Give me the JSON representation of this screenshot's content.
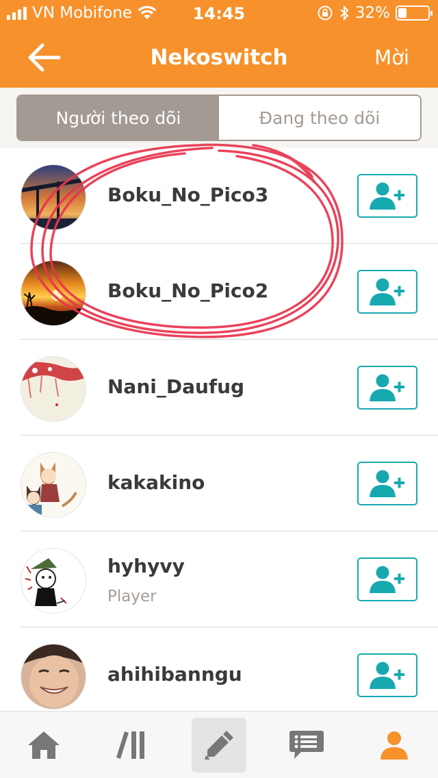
{
  "status_bar": {
    "carrier": "VN Mobifone",
    "time": "14:45",
    "battery": "32%",
    "battery_level": 0.32
  },
  "nav": {
    "title": "Nekoswitch",
    "invite_label": "Mời",
    "back_icon": "arrow-left-icon"
  },
  "tabs": {
    "followers_label": "Người theo dõi",
    "following_label": "Đang theo dõi",
    "selected": "followers"
  },
  "users": [
    {
      "name": "Boku_No_Pico3",
      "subtitle": "",
      "avatar": "bridge-sunset-photo"
    },
    {
      "name": "Boku_No_Pico2",
      "subtitle": "",
      "avatar": "orange-sunset-photo"
    },
    {
      "name": "Nani_Daufug",
      "subtitle": "",
      "avatar": "red-ink-painting"
    },
    {
      "name": "kakakino",
      "subtitle": "",
      "avatar": "anime-cat-kids-drawing"
    },
    {
      "name": "hyhyvy",
      "subtitle": "Player",
      "avatar": "sketch-character-drawing"
    },
    {
      "name": "ahihibanngu",
      "subtitle": "",
      "avatar": "smiling-face-photo"
    }
  ],
  "tab_bar": {
    "items": [
      "home-icon",
      "library-icon",
      "pencil-icon",
      "chat-list-icon",
      "profile-icon"
    ],
    "active": "profile-icon",
    "active_color": "#f7912b"
  },
  "colors": {
    "header": "#f7912b",
    "follow_button": "#16a9b0",
    "segment_active": "#a39a93",
    "annotation": "#e8344e"
  }
}
